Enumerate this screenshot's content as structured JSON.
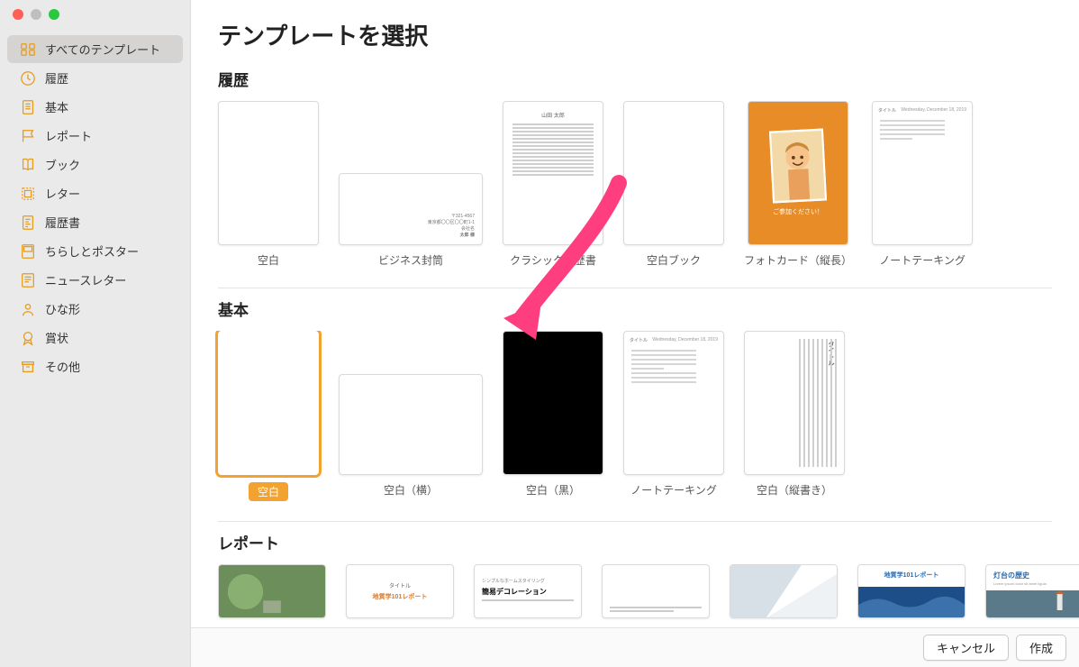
{
  "window": {
    "title": "テンプレートを選択"
  },
  "sidebar": {
    "items": [
      {
        "label": "すべてのテンプレート",
        "icon": "grid-icon",
        "active": true
      },
      {
        "label": "履歴",
        "icon": "clock-icon"
      },
      {
        "label": "基本",
        "icon": "page-icon"
      },
      {
        "label": "レポート",
        "icon": "badge-icon"
      },
      {
        "label": "ブック",
        "icon": "book-icon"
      },
      {
        "label": "レター",
        "icon": "stamp-icon"
      },
      {
        "label": "履歴書",
        "icon": "resume-icon"
      },
      {
        "label": "ちらしとポスター",
        "icon": "poster-icon"
      },
      {
        "label": "ニュースレター",
        "icon": "newsletter-icon"
      },
      {
        "label": "ひな形",
        "icon": "person-icon"
      },
      {
        "label": "賞状",
        "icon": "award-icon"
      },
      {
        "label": "その他",
        "icon": "archive-icon"
      }
    ]
  },
  "sections": {
    "recent": {
      "title": "履歴",
      "items": [
        {
          "label": "空白"
        },
        {
          "label": "ビジネス封筒"
        },
        {
          "label": "クラシック履歴書"
        },
        {
          "label": "空白ブック"
        },
        {
          "label": "フォトカード（縦長）",
          "photo_caption": "ご参加ください！"
        },
        {
          "label": "ノートテーキング"
        }
      ]
    },
    "basic": {
      "title": "基本",
      "items": [
        {
          "label": "空白",
          "selected": true
        },
        {
          "label": "空白（横）"
        },
        {
          "label": "空白（黒）"
        },
        {
          "label": "ノートテーキング"
        },
        {
          "label": "空白（縦書き）"
        }
      ]
    },
    "report": {
      "title": "レポート",
      "items": [
        {
          "label": ""
        },
        {
          "label": "",
          "heading": "地質学101レポート"
        },
        {
          "label": "",
          "heading_small": "シンプルなホームスタイリング",
          "heading": "簡易デコレーション"
        },
        {
          "label": ""
        },
        {
          "label": ""
        },
        {
          "label": "",
          "heading": "地質学101レポート"
        },
        {
          "label": "",
          "heading": "灯台の歴史"
        }
      ]
    }
  },
  "footer": {
    "cancel": "キャンセル",
    "create": "作成"
  },
  "colors": {
    "accent": "#f3a22f"
  }
}
